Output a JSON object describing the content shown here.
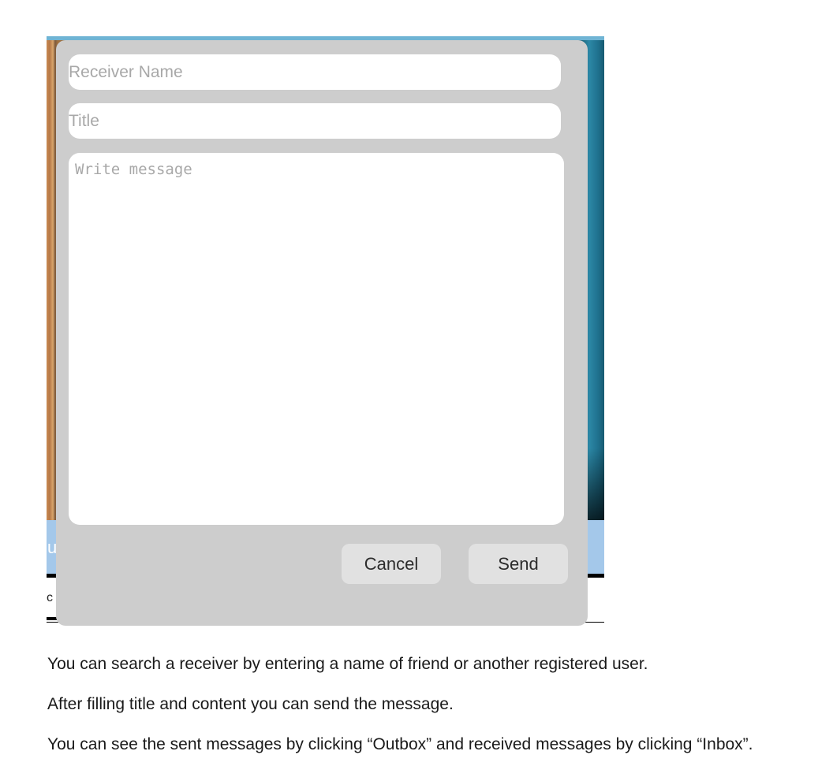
{
  "compose_dialog": {
    "receiver_placeholder": "Receiver Name",
    "title_placeholder": "Title",
    "message_placeholder": "Write message",
    "cancel_label": "Cancel",
    "send_label": "Send"
  },
  "background_app": {
    "band_text": "u",
    "below_text": "c"
  },
  "document": {
    "lines": [
      "You can search a receiver by entering a name of friend or another registered user.",
      "After filling title and content you can send the message.",
      "You can see the sent messages by clicking “Outbox” and received messages by clicking “Inbox”."
    ]
  }
}
